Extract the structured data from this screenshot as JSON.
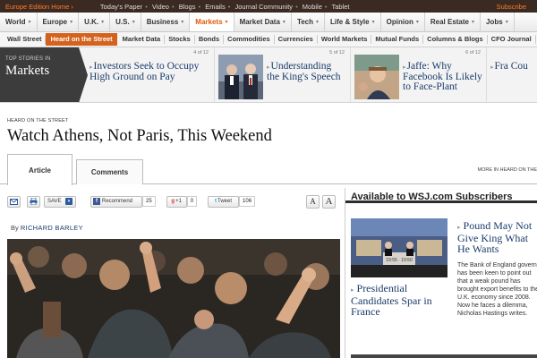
{
  "topbar": {
    "edition": "Europe Edition Home",
    "edition_caret": "›",
    "links": [
      "Today's Paper",
      "Video",
      "Blogs",
      "Emails",
      "Journal Community",
      "Mobile",
      "Tablet"
    ],
    "subscribe": "Subscribe"
  },
  "nav1": {
    "items": [
      {
        "label": "World"
      },
      {
        "label": "Europe"
      },
      {
        "label": "U.K."
      },
      {
        "label": "U.S."
      },
      {
        "label": "Business"
      },
      {
        "label": "Markets"
      },
      {
        "label": "Market Data"
      },
      {
        "label": "Tech"
      },
      {
        "label": "Life & Style"
      },
      {
        "label": "Opinion"
      },
      {
        "label": "Real Estate"
      },
      {
        "label": "Jobs"
      }
    ],
    "active_index": 5,
    "caret": "▾"
  },
  "nav2": {
    "items": [
      "Wall Street",
      "Heard on the Street",
      "Market Data",
      "Stocks",
      "Bonds",
      "Commodities",
      "Currencies",
      "World Markets",
      "Mutual Funds",
      "Columns & Blogs",
      "CFO Journal"
    ],
    "active_index": 1
  },
  "top_stories": {
    "label_small": "TOP STORIES IN",
    "label_big": "Markets",
    "stories": [
      {
        "counter": "4 of 12",
        "headline": "Investors Seek to Occupy High Ground on Pay"
      },
      {
        "counter": "5 of 12",
        "headline": "Understanding the King's Speech"
      },
      {
        "counter": "6 of 12",
        "headline": "Jaffe: Why Facebook Is Likely to Face-Plant"
      },
      {
        "counter": "",
        "headline": "Fra Cou"
      }
    ]
  },
  "article": {
    "kicker": "HEARD ON THE STREET",
    "headline": "Watch Athens, Not Paris, This Weekend",
    "tabs": {
      "article": "Article",
      "comments": "Comments"
    },
    "more_in": "MORE IN HEARD ON THE",
    "byline_prefix": "By",
    "byline_name": "RICHARD BARLEY"
  },
  "tools": {
    "save_label": "SAVE",
    "facebook_label": "Recommend",
    "facebook_count": "25",
    "gplus_label": "+1",
    "gplus_count": "0",
    "tweet_label": "Tweet",
    "tweet_count": "106",
    "font_small": "A",
    "font_large": "A"
  },
  "sidebar": {
    "title": "Available to WSJ.com Subscribers",
    "story1": {
      "headline": "Presidential Candidates Spar in France"
    },
    "story2": {
      "headline": "Pound May Not Give King What He Wants",
      "body": "The Bank of England governor has been keen to point out that a weak pound has brought export benefits to the U.K. economy since 2008. Now he faces a dilemma, Nicholas Hastings writes."
    },
    "tv_caption": "19:55 · 19:50"
  },
  "colors": {
    "accent": "#e05a0a",
    "topbar_bg": "#3a2a22",
    "link": "#1a3b6b"
  }
}
